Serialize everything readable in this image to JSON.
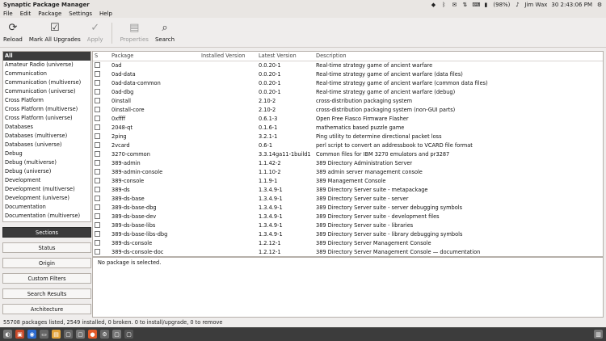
{
  "window": {
    "title": "Synaptic Package Manager"
  },
  "menu": [
    "File",
    "Edit",
    "Package",
    "Settings",
    "Help"
  ],
  "tray": {
    "battery": "(98%)",
    "user": "Jim Wax",
    "datetime": "30 2:43:06 PM"
  },
  "toolbar": {
    "reload": "Reload",
    "mark_all": "Mark All Upgrades",
    "apply": "Apply",
    "properties": "Properties",
    "search": "Search"
  },
  "sections": [
    "All",
    "Amateur Radio (universe)",
    "Communication",
    "Communication (multiverse)",
    "Communication (universe)",
    "Cross Platform",
    "Cross Platform (multiverse)",
    "Cross Platform (universe)",
    "Databases",
    "Databases (multiverse)",
    "Databases (universe)",
    "Debug",
    "Debug (multiverse)",
    "Debug (universe)",
    "Development",
    "Development (multiverse)",
    "Development (universe)",
    "Documentation",
    "Documentation (multiverse)"
  ],
  "filter_buttons": [
    "Sections",
    "Status",
    "Origin",
    "Custom Filters",
    "Search Results",
    "Architecture"
  ],
  "columns": {
    "s": "S",
    "package": "Package",
    "installed": "Installed Version",
    "latest": "Latest Version",
    "description": "Description"
  },
  "packages": [
    {
      "name": "0ad",
      "installed": "",
      "latest": "0.0.20-1",
      "desc": "Real-time strategy game of ancient warfare"
    },
    {
      "name": "0ad-data",
      "installed": "",
      "latest": "0.0.20-1",
      "desc": "Real-time strategy game of ancient warfare (data files)"
    },
    {
      "name": "0ad-data-common",
      "installed": "",
      "latest": "0.0.20-1",
      "desc": "Real-time strategy game of ancient warfare (common data files)"
    },
    {
      "name": "0ad-dbg",
      "installed": "",
      "latest": "0.0.20-1",
      "desc": "Real-time strategy game of ancient warfare (debug)"
    },
    {
      "name": "0install",
      "installed": "",
      "latest": "2.10-2",
      "desc": "cross-distribution packaging system"
    },
    {
      "name": "0install-core",
      "installed": "",
      "latest": "2.10-2",
      "desc": "cross-distribution packaging system (non-GUI parts)"
    },
    {
      "name": "0xffff",
      "installed": "",
      "latest": "0.6.1-3",
      "desc": "Open Free Fiasco Firmware Flasher"
    },
    {
      "name": "2048-qt",
      "installed": "",
      "latest": "0.1.6-1",
      "desc": "mathematics based puzzle game"
    },
    {
      "name": "2ping",
      "installed": "",
      "latest": "3.2.1-1",
      "desc": "Ping utility to determine directional packet loss"
    },
    {
      "name": "2vcard",
      "installed": "",
      "latest": "0.6-1",
      "desc": "perl script to convert an addressbook to VCARD file format"
    },
    {
      "name": "3270-common",
      "installed": "",
      "latest": "3.3.14ga11-1build1",
      "desc": "Common files for IBM 3270 emulators and pr3287"
    },
    {
      "name": "389-admin",
      "installed": "",
      "latest": "1.1.42-2",
      "desc": "389 Directory Administration Server"
    },
    {
      "name": "389-admin-console",
      "installed": "",
      "latest": "1.1.10-2",
      "desc": "389 admin server management console"
    },
    {
      "name": "389-console",
      "installed": "",
      "latest": "1.1.9-1",
      "desc": "389 Management Console"
    },
    {
      "name": "389-ds",
      "installed": "",
      "latest": "1.3.4.9-1",
      "desc": "389 Directory Server suite - metapackage"
    },
    {
      "name": "389-ds-base",
      "installed": "",
      "latest": "1.3.4.9-1",
      "desc": "389 Directory Server suite - server"
    },
    {
      "name": "389-ds-base-dbg",
      "installed": "",
      "latest": "1.3.4.9-1",
      "desc": "389 Directory Server suite - server debugging symbols"
    },
    {
      "name": "389-ds-base-dev",
      "installed": "",
      "latest": "1.3.4.9-1",
      "desc": "389 Directory Server suite - development files"
    },
    {
      "name": "389-ds-base-libs",
      "installed": "",
      "latest": "1.3.4.9-1",
      "desc": "389 Directory Server suite - libraries"
    },
    {
      "name": "389-ds-base-libs-dbg",
      "installed": "",
      "latest": "1.3.4.9-1",
      "desc": "389 Directory Server suite - library debugging symbols"
    },
    {
      "name": "389-ds-console",
      "installed": "",
      "latest": "1.2.12-1",
      "desc": "389 Directory Server Management Console"
    },
    {
      "name": "389-ds-console-doc",
      "installed": "",
      "latest": "1.2.12-1",
      "desc": "389 Directory Server Management Console — documentation"
    }
  ],
  "description_panel": "No package is selected.",
  "status": "55708 packages listed, 2549 installed, 0 broken. 0 to install/upgrade, 0 to remove"
}
